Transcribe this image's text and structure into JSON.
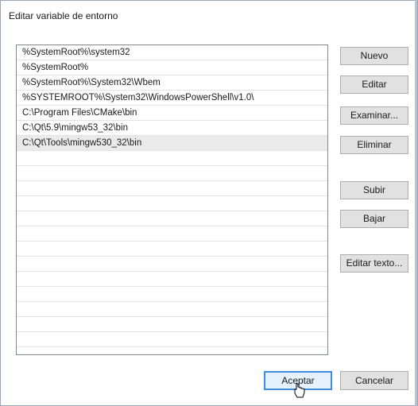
{
  "window": {
    "title": "Editar variable de entorno"
  },
  "list": {
    "items": [
      {
        "label": "%SystemRoot%\\system32"
      },
      {
        "label": "%SystemRoot%"
      },
      {
        "label": "%SystemRoot%\\System32\\Wbem"
      },
      {
        "label": "%SYSTEMROOT%\\System32\\WindowsPowerShell\\v1.0\\"
      },
      {
        "label": "C:\\Program Files\\CMake\\bin"
      },
      {
        "label": "C:\\Qt\\5.9\\mingw53_32\\bin"
      },
      {
        "label": "C:\\Qt\\Tools\\mingw530_32\\bin"
      }
    ],
    "selected_index": 6
  },
  "buttons": {
    "nuevo": "Nuevo",
    "editar": "Editar",
    "examinar": "Examinar...",
    "eliminar": "Eliminar",
    "subir": "Subir",
    "bajar": "Bajar",
    "editar_texto": "Editar texto...",
    "aceptar": "Aceptar",
    "cancelar": "Cancelar"
  },
  "colors": {
    "accent": "#3c8de0",
    "selected_row": "#eaeaea",
    "button_face": "#e1e1e1"
  }
}
